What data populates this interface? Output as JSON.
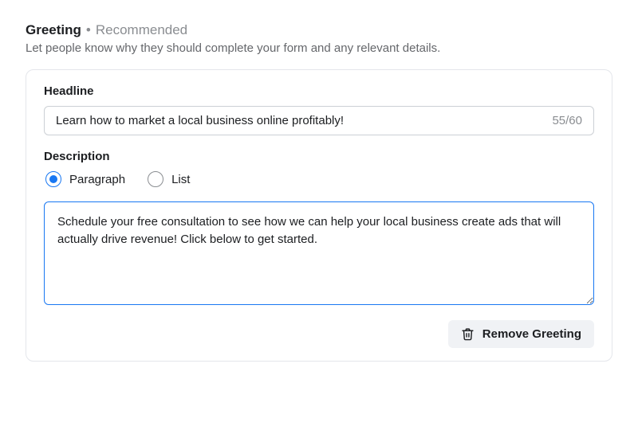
{
  "header": {
    "title": "Greeting",
    "tag": "Recommended",
    "subtitle": "Let people know why they should complete your form and any relevant details."
  },
  "headline": {
    "label": "Headline",
    "value": "Learn how to market a local business online profitably!",
    "counter": "55/60"
  },
  "description": {
    "label": "Description",
    "options": {
      "paragraph": "Paragraph",
      "list": "List"
    },
    "selected": "paragraph",
    "value": "Schedule your free consultation to see how we can help your local business create ads that will actually drive revenue! Click below to get started."
  },
  "footer": {
    "remove_label": "Remove Greeting"
  }
}
